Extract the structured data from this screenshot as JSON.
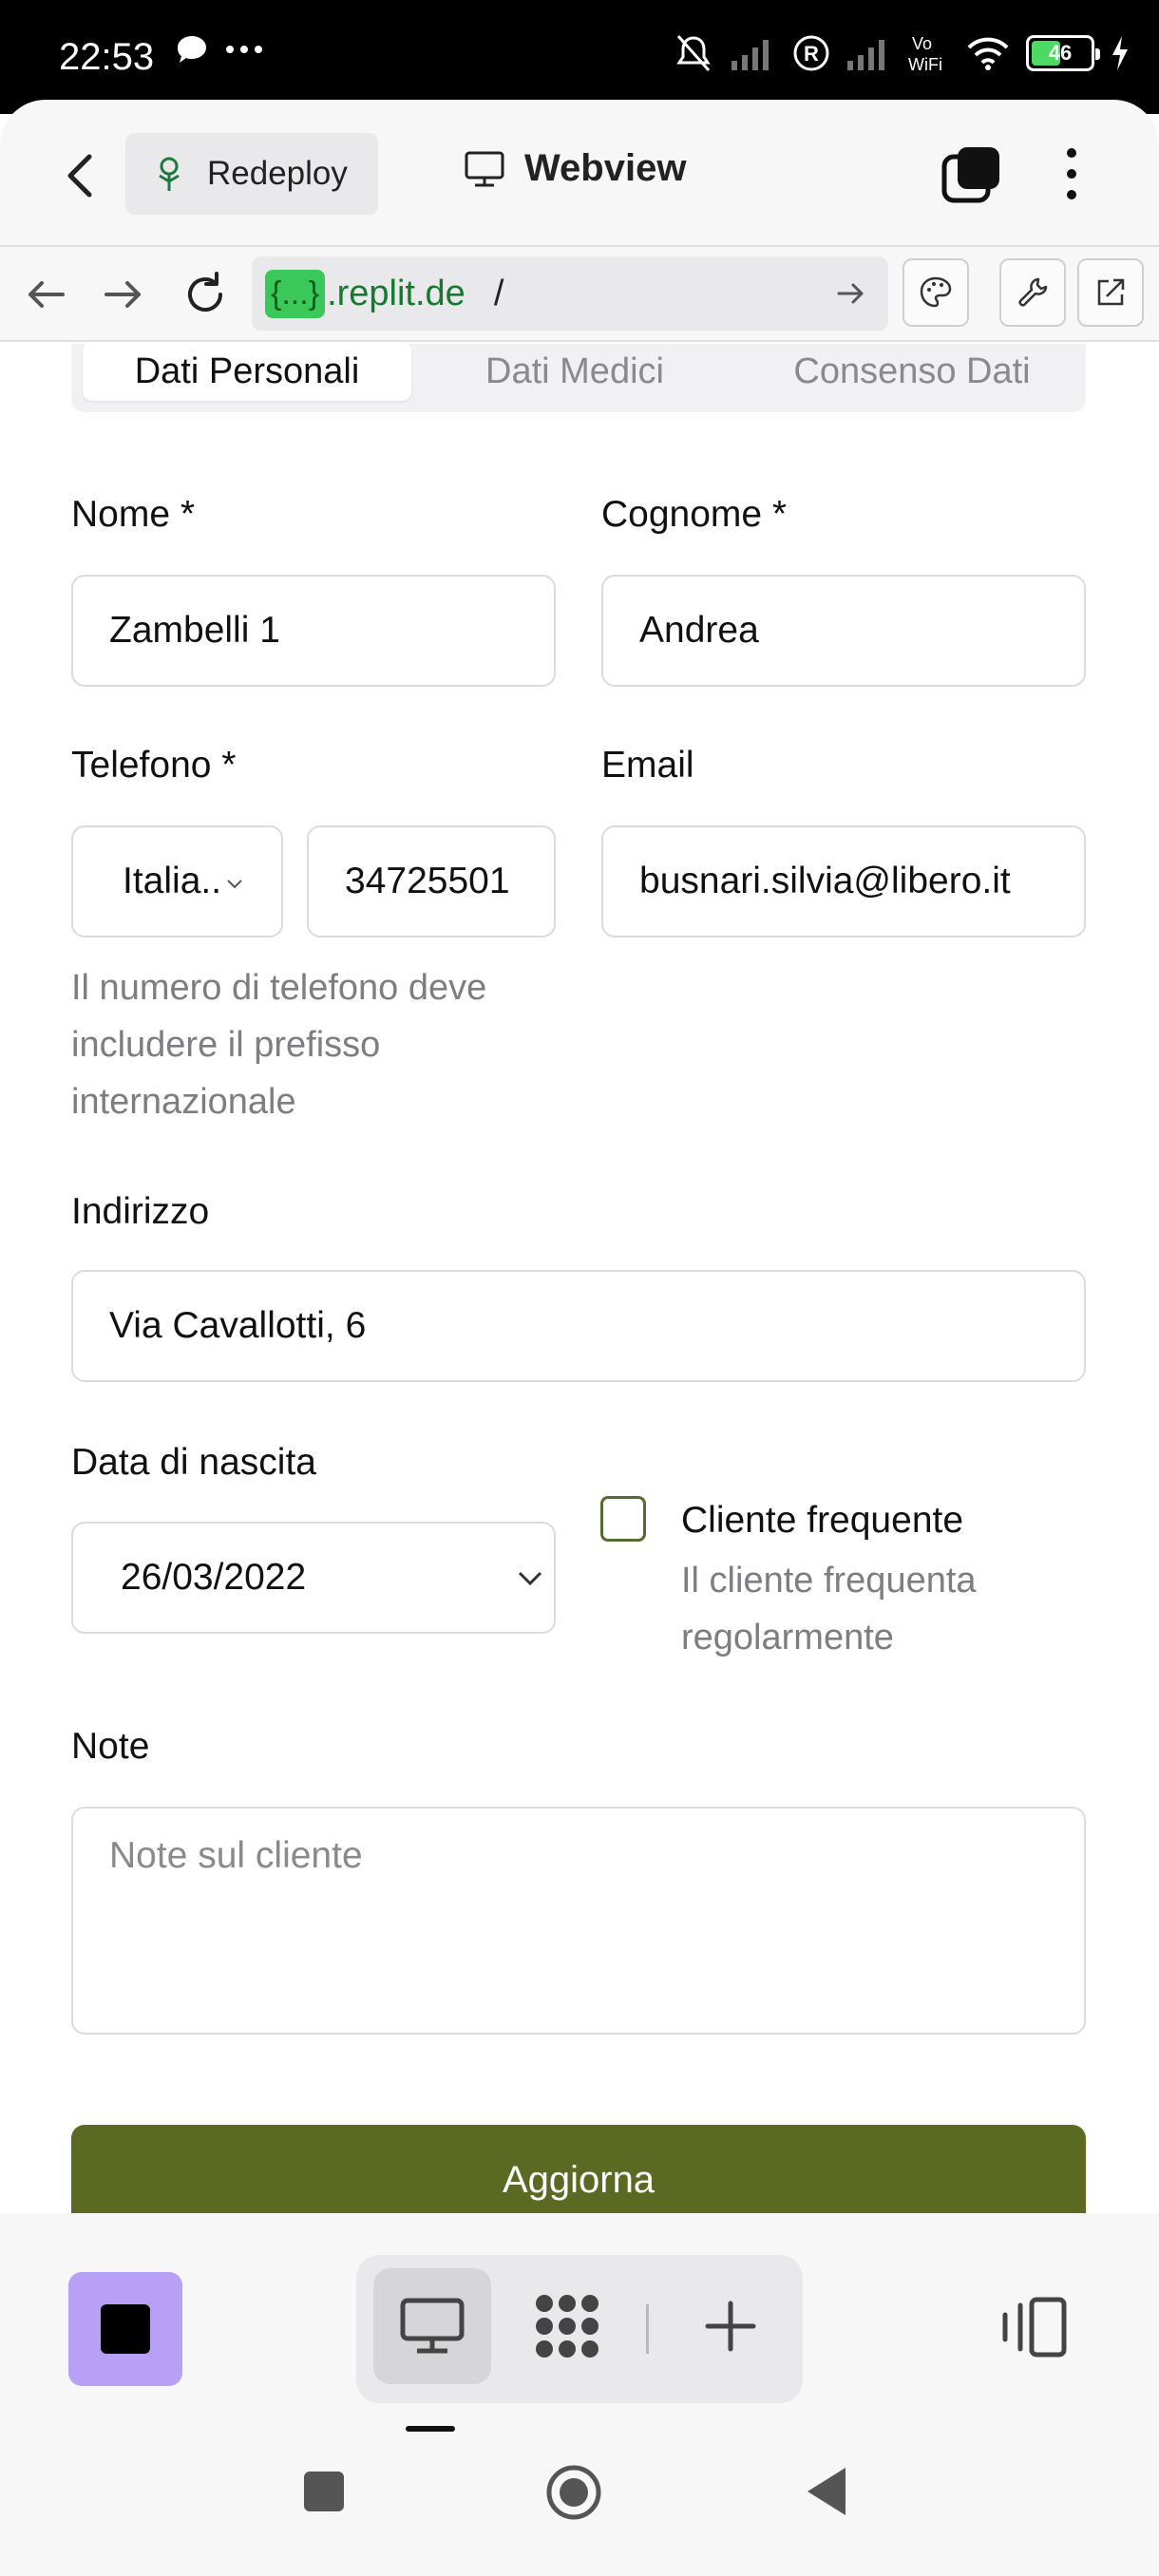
{
  "status_bar": {
    "time": "22:53",
    "battery": "46"
  },
  "app_bar": {
    "redeploy_label": "Redeploy",
    "title": "Webview"
  },
  "url_bar": {
    "badge": "{...}",
    "domain": ".replit.de",
    "path": "/"
  },
  "tabs": [
    {
      "label": "Dati Personali",
      "active": true
    },
    {
      "label": "Dati Medici",
      "active": false
    },
    {
      "label": "Consenso Dati",
      "active": false
    }
  ],
  "form": {
    "nome_label": "Nome *",
    "nome_value": "Zambelli 1",
    "cognome_label": "Cognome *",
    "cognome_value": "Andrea",
    "telefono_label": "Telefono *",
    "country_value": "Italia..",
    "phone_value": "34725501",
    "email_label": "Email",
    "email_value": "busnari.silvia@libero.it",
    "phone_help": [
      "Il numero di telefono deve",
      "includere il prefisso",
      "internazionale"
    ],
    "indirizzo_label": "Indirizzo",
    "indirizzo_value": "Via Cavallotti, 6",
    "nascita_label": "Data di nascita",
    "nascita_value": "26/03/2022",
    "frequente_label": "Cliente frequente",
    "frequente_help": [
      "Il cliente frequenta",
      "regolarmente"
    ],
    "frequente_checked": false,
    "note_label": "Note",
    "note_placeholder": "Note sul cliente",
    "submit_label": "Aggiorna"
  },
  "colors": {
    "accent": "#5a6a22",
    "stop_button": "#b7a0f5",
    "url_badge": "#3ac85a"
  }
}
